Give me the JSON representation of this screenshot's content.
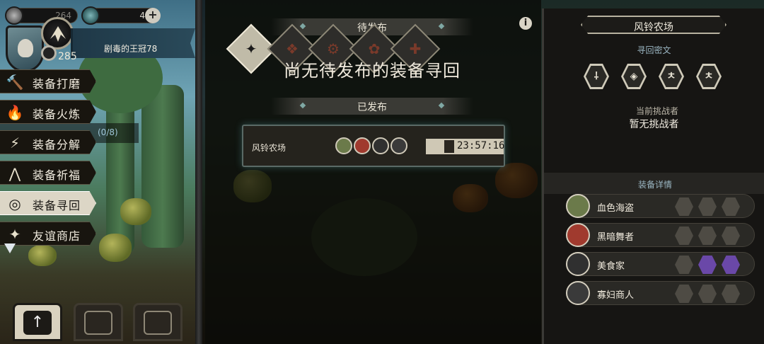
{
  "status": {
    "stat_a": "264",
    "gems": "4",
    "power": "285",
    "player_name": "剧毒的王冠78"
  },
  "menu": [
    {
      "label": "装备打磨",
      "icon": "hammer-icon",
      "glyph": "🔨"
    },
    {
      "label": "装备火炼",
      "icon": "flame-icon",
      "glyph": "🔥"
    },
    {
      "label": "装备分解",
      "icon": "break-icon",
      "glyph": "⚡"
    },
    {
      "label": "装备祈福",
      "icon": "pray-icon",
      "glyph": "⋀"
    },
    {
      "label": "装备寻回",
      "icon": "target-icon",
      "glyph": "◎"
    },
    {
      "label": "友谊商店",
      "icon": "fox-icon",
      "glyph": "✦"
    }
  ],
  "progress": "(0/8)",
  "center": {
    "pending_header": "待发布",
    "empty_message": "尚无待发布的装备寻回",
    "published_header": "已发布",
    "card": {
      "name": "风铃农场",
      "timer": "23:57:16"
    }
  },
  "right": {
    "title": "风铃农场",
    "cipher_label": "寻回密文",
    "cipher_glyphs": [
      "⸸",
      "◈",
      "ㅊ",
      "ㅊ"
    ],
    "challenger_label": "当前挑战者",
    "challenger_value": "暂无挑战者",
    "equip_label": "装备详情",
    "equipment": [
      {
        "name": "血色海盗",
        "color": "#6b7a4a",
        "active": false
      },
      {
        "name": "黑暗舞者",
        "color": "#a03a2e",
        "active": false
      },
      {
        "name": "美食家",
        "color": "#303030",
        "active": true
      },
      {
        "name": "寡妇商人",
        "color": "#3a3a3a",
        "active": false
      }
    ]
  },
  "colors": {
    "accent_teal": "#7fa8a4",
    "slot_active": "#6a48a8"
  }
}
